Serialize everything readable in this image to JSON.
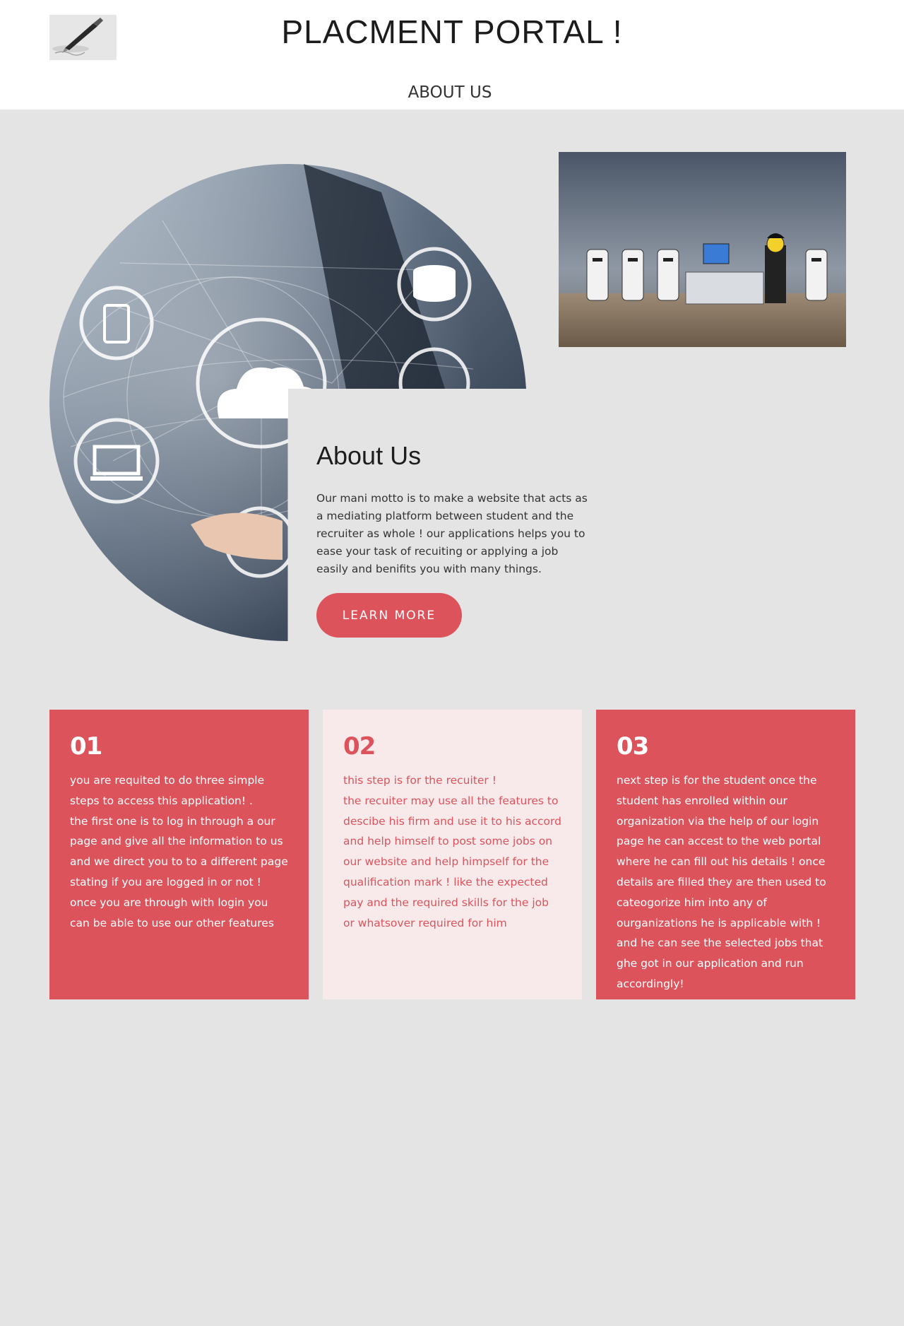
{
  "header": {
    "title": "PLACMENT PORTAL !",
    "nav": {
      "about_label": "ABOUT US"
    }
  },
  "about": {
    "heading": "About Us",
    "text": "Our mani motto is to make a website that acts as a mediating platform between student and the recruiter as whole ! our applications helps you to ease your task of recuiting or applying a job easily and benifits you with many things.",
    "button_label": "LEARN MORE"
  },
  "steps": [
    {
      "number": "01",
      "text": "you are requited to do three simple steps to access this application! .\nthe first one is to log in through a our page and give all the information to us and we direct you to to a different page stating if you are logged in or not ! once you are through with login you can be able to use our other features"
    },
    {
      "number": "02",
      "text": "this step is for the recuiter !\nthe recuiter may use all the features to descibe his firm and use it to his accord and help himself to post some jobs on our website and help himpself for the qualification mark ! like the expected pay and the required skills for the job or whatsover required for him"
    },
    {
      "number": "03",
      "text": "next step is for the student once the student has enrolled within our organization via the help of our login page he can accest to the web portal where he can fill out his details ! once details are filled they are then used to cateogorize him into any of ourganizations he is applicable with ! and he can see the selected jobs that ghe got in our application and run accordingly!"
    }
  ],
  "colors": {
    "accent": "#dc535c",
    "pale_card": "#f8eaeb",
    "page_bg": "#e4e4e4"
  }
}
